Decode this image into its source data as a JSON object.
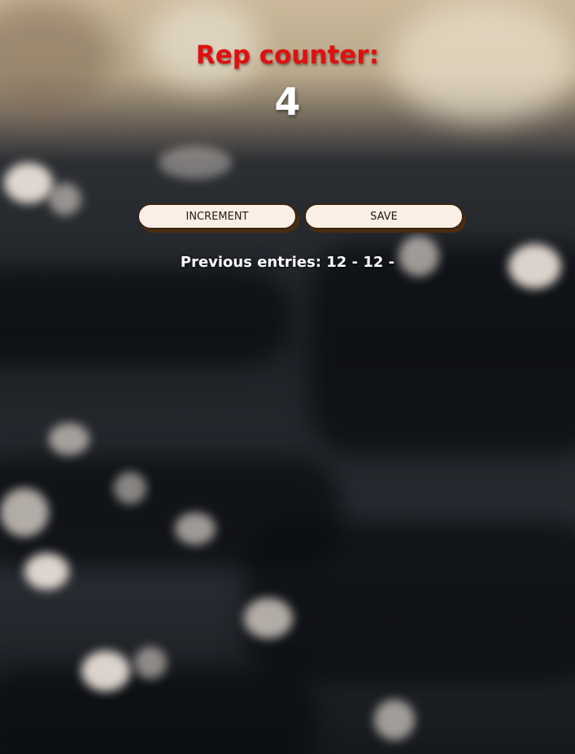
{
  "app": {
    "title": "Rep counter:",
    "count": "4"
  },
  "actions": {
    "increment_label": "INCREMENT",
    "save_label": "SAVE"
  },
  "history": {
    "text": "Previous entries: 12 - 12 -"
  },
  "colors": {
    "title": "#e01010",
    "button_bg": "#fbefe6",
    "button_border": "#3a2412"
  }
}
